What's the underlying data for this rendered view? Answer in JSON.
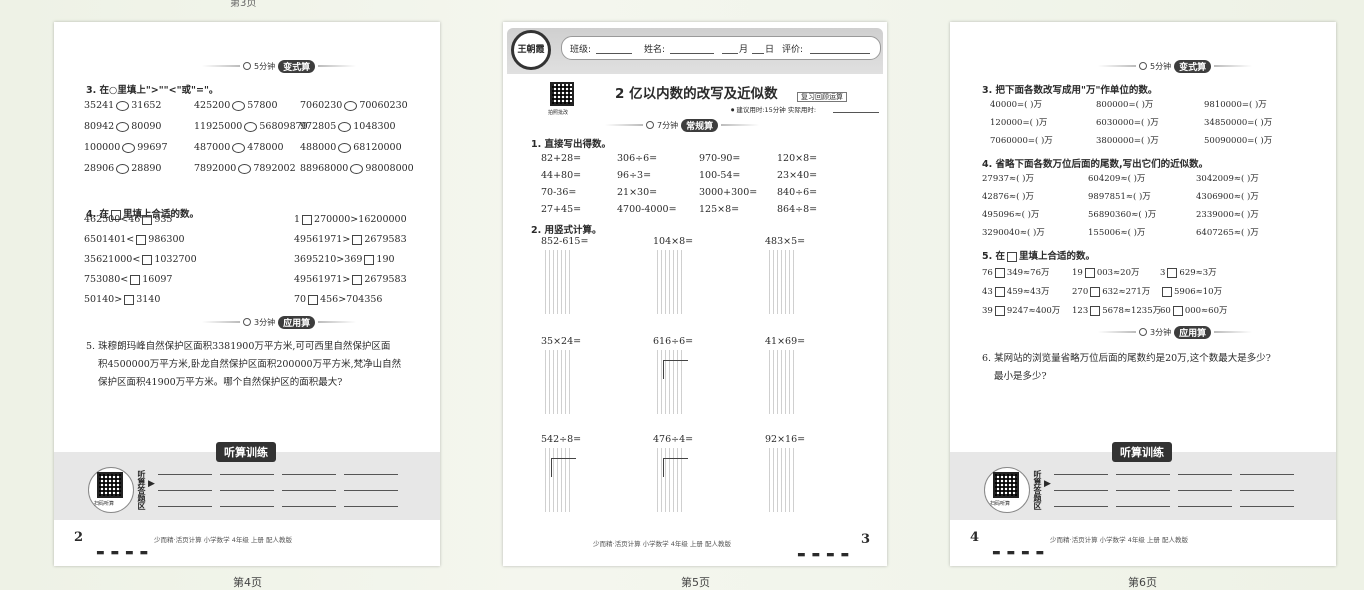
{
  "captions": {
    "p4": "第4页",
    "p5": "第5页",
    "p6": "第6页"
  },
  "p4": {
    "timer1": {
      "time": "5分钟",
      "label": "变式算"
    },
    "q3_title": "3. 在○里填上\">\"\"<\"或\"=\"。",
    "q3_rows": [
      [
        [
          "35241",
          "31652"
        ],
        [
          "425200",
          "57800"
        ],
        [
          "7060230",
          "70060230"
        ]
      ],
      [
        [
          "80942",
          "80090"
        ],
        [
          "11925000",
          "56809870"
        ],
        [
          "972805",
          "1048300"
        ]
      ],
      [
        [
          "100000",
          "99697"
        ],
        [
          "487000",
          "478000"
        ],
        [
          "488000",
          "68120000"
        ]
      ],
      [
        [
          "28906",
          "28890"
        ],
        [
          "7892000",
          "7892002"
        ],
        [
          "88968000",
          "98008000"
        ]
      ]
    ],
    "q4_title_a": "4. 在",
    "q4_title_b": "里填上合适的数。",
    "q4_rows": [
      [
        [
          "462500<46",
          "935"
        ],
        [
          "1",
          "270000>16200000"
        ]
      ],
      [
        [
          "6501401<",
          "986300"
        ],
        [
          "49561971>",
          "2679583"
        ]
      ],
      [
        [
          "35621000<",
          "1032700"
        ],
        [
          "3695210>369",
          "190"
        ]
      ],
      [
        [
          "753080<",
          "16097"
        ],
        [
          "49561971>",
          "2679583"
        ]
      ],
      [
        [
          "50140>",
          "3140"
        ],
        [
          "70",
          "456>704356"
        ]
      ]
    ],
    "timer2": {
      "time": "3分钟",
      "label": "应用算"
    },
    "q5_lines": [
      "5. 珠穆朗玛峰自然保护区面积3381900万平方米,可可西里自然保护区面",
      "积4500000万平方米,卧龙自然保护区面积200000万平方米,梵净山自然",
      "保护区面积41900万平方米。哪个自然保护区的面积最大?"
    ],
    "listen": "听算训练",
    "listen_side": "听算答题区",
    "qr_label": "扫码听算",
    "footer": "少而精·活页计算  小学数学  4年级  上册  配人教版",
    "page_no": "2"
  },
  "p5": {
    "logo": "王朝霞",
    "info": {
      "class": "班级:",
      "name": "姓名:",
      "month": "月",
      "day": "日",
      "eval": "评价:"
    },
    "title": "2 亿以内数的改写及近似数",
    "tag": "复习回顾运算",
    "qr_label": "拍照批改",
    "time_hint": "建议用时:15分钟   实际用时:",
    "timer": {
      "time": "7分钟",
      "label": "常规算"
    },
    "q1_title": "1. 直接写出得数。",
    "q1_rows": [
      [
        "82+28=",
        "306÷6=",
        "970-90=",
        "120×8="
      ],
      [
        "44+80=",
        "96÷3=",
        "100-54=",
        "23×40="
      ],
      [
        "70-36=",
        "21×30=",
        "3000+300=",
        "840÷6="
      ],
      [
        "27+45=",
        "4700-4000=",
        "125×8=",
        "864÷8="
      ]
    ],
    "q2_title": "2. 用竖式计算。",
    "q2_rows": [
      [
        "852-615=",
        "104×8=",
        "483×5="
      ],
      [
        "35×24=",
        "616÷6=",
        "41×69="
      ],
      [
        "542÷8=",
        "476÷4=",
        "92×16="
      ]
    ],
    "footer": "少而精·活页计算  小学数学  4年级  上册  配人教版",
    "page_no": "3"
  },
  "p6": {
    "timer1": {
      "time": "5分钟",
      "label": "变式算"
    },
    "q3_title": "3. 把下面各数改写成用\"万\"作单位的数。",
    "q3_rows": [
      [
        "40000=(    )万",
        "800000=(    )万",
        "9810000=(    )万"
      ],
      [
        "120000=(    )万",
        "6030000=(    )万",
        "34850000=(    )万"
      ],
      [
        "7060000=(    )万",
        "3800000=(    )万",
        "50090000=(    )万"
      ]
    ],
    "q4_title": "4. 省略下面各数万位后面的尾数,写出它们的近似数。",
    "q4_rows": [
      [
        "27937≈(    )万",
        "604209≈(    )万",
        "3042009≈(    )万"
      ],
      [
        "42876≈(    )万",
        "9897851≈(    )万",
        "4306900≈(    )万"
      ],
      [
        "495096≈(    )万",
        "56890360≈(    )万",
        "2339000≈(    )万"
      ],
      [
        "3290040≈(    )万",
        "155006≈(    )万",
        "6407265≈(    )万"
      ]
    ],
    "q5_title_a": "5. 在",
    "q5_title_b": "里填上合适的数。",
    "q5_rows": [
      [
        [
          "76",
          "349≈76万"
        ],
        [
          "19",
          "003≈20万"
        ],
        [
          "3",
          "629≈3万"
        ]
      ],
      [
        [
          "43",
          "459≈43万"
        ],
        [
          "270",
          "632≈271万"
        ],
        [
          "",
          "5906≈10万"
        ]
      ],
      [
        [
          "39",
          "9247≈400万"
        ],
        [
          "123",
          "5678≈1235万"
        ],
        [
          "60",
          "000≈60万"
        ]
      ]
    ],
    "timer2": {
      "time": "3分钟",
      "label": "应用算"
    },
    "q6_lines": [
      "6. 某网站的浏览量省略万位后面的尾数约是20万,这个数最大是多少?",
      "最小是多少?"
    ],
    "listen": "听算训练",
    "listen_side": "听算答题区",
    "qr_label": "扫码听算",
    "footer": "少而精·活页计算  小学数学  4年级  上册  配人教版",
    "page_no": "4"
  }
}
